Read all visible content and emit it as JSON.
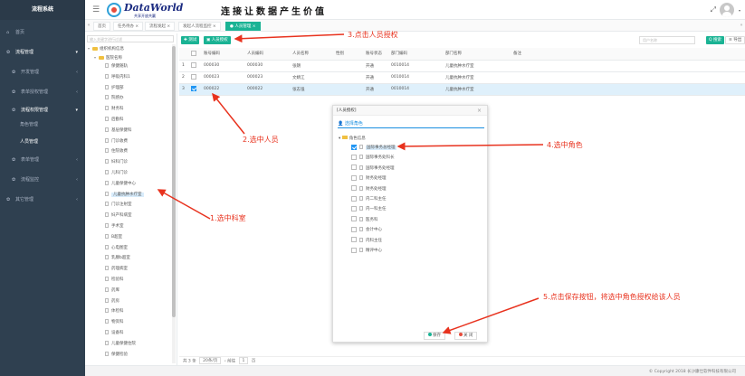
{
  "sidebar": {
    "brand": "流程系统",
    "items": [
      {
        "label": "首页",
        "icon": "home-icon"
      },
      {
        "label": "流程管理",
        "icon": "gear-icon"
      },
      {
        "label": "开发管理",
        "icon": "gear-icon"
      },
      {
        "label": "表单授权管理",
        "icon": "gear-icon"
      },
      {
        "label": "流程权限管理",
        "icon": "gear-icon"
      },
      {
        "label": "表单管理",
        "icon": "gear-icon"
      },
      {
        "label": "流程监控",
        "icon": "gear-icon"
      },
      {
        "label": "其它管理",
        "icon": "gear-icon"
      }
    ],
    "subitems": [
      {
        "label": "角色管理"
      },
      {
        "label": "人员管理"
      }
    ]
  },
  "header": {
    "logo_text": "DataWorld",
    "logo_sub": "共享开放共赢",
    "slogan": "连接让数据产生价值"
  },
  "tabs": [
    {
      "label": "首页"
    },
    {
      "label": "任务待办 ×"
    },
    {
      "label": "流程发起 ×"
    },
    {
      "label": "发起人流程监控 ×"
    },
    {
      "label": "● 人员管理 ×"
    }
  ],
  "tree": {
    "search_placeholder": "输入关键字进行过滤",
    "root": "组织机构信息",
    "group": "医院名称",
    "departments": [
      "保健随轨",
      "呼吸内科1",
      "护理部",
      "院感办",
      "财务科",
      "后勤科",
      "基层保健科",
      "门诊收费",
      "住院收费",
      "妇科门诊",
      "儿科门诊",
      "儿童保健中心",
      "儿童抗肿水疗室",
      "门诊注射室",
      "妇产科病室",
      "手术室",
      "B超室",
      "心电图室",
      "乳腺b超室",
      "药理病室",
      "检验科",
      "药库",
      "药房",
      "体检科",
      "物资科",
      "设备科",
      "儿童保健住院",
      "保健检验"
    ],
    "selected": "儿童抗肿水疗室"
  },
  "toolbar": {
    "add_label": "✚ 测试",
    "auth_label": "▣ 人员授权",
    "search_placeholder": "用户名称",
    "search_btn": "Q 搜索",
    "export_btn": "≡ 导出"
  },
  "table": {
    "headers": [
      "",
      "账号编码",
      "人员编码",
      "人员名称",
      "性别",
      "账号状态",
      "部门编码",
      "部门名称",
      "备注"
    ],
    "rows": [
      {
        "idx": "1",
        "account": "000030",
        "person": "000030",
        "name": "张朗",
        "gender": "",
        "status": "开通",
        "dept_code": "0010014",
        "dept_name": "儿童抗肿水疗室",
        "remark": "",
        "checked": false
      },
      {
        "idx": "2",
        "account": "000023",
        "person": "000023",
        "name": "文婧江",
        "gender": "",
        "status": "开通",
        "dept_code": "0010014",
        "dept_name": "儿童抗肿水疗室",
        "remark": "",
        "checked": false
      },
      {
        "idx": "3",
        "account": "000022",
        "person": "000022",
        "name": "张志强",
        "gender": "",
        "status": "开通",
        "dept_code": "0010014",
        "dept_name": "儿童抗肿水疗室",
        "remark": "",
        "checked": true
      }
    ]
  },
  "pager": {
    "total": "共 3 条",
    "page_size": "20条/页",
    "goto": "前往",
    "page": "1",
    "page_unit": "页"
  },
  "footer": {
    "copyright": "© Copyright 2018 长沙康仕软件科技有限公司"
  },
  "modal": {
    "title": "[人员授权]",
    "tab": "选择角色",
    "root": "角色信息",
    "roles": [
      {
        "label": "国际事务总经理",
        "checked": true
      },
      {
        "label": "国际事务处科长",
        "checked": false
      },
      {
        "label": "国际事务处经理",
        "checked": false
      },
      {
        "label": "财务处经理",
        "checked": false
      },
      {
        "label": "财务处经理",
        "checked": false
      },
      {
        "label": "内二科主任",
        "checked": false
      },
      {
        "label": "内一科主任",
        "checked": false
      },
      {
        "label": "医务科",
        "checked": false
      },
      {
        "label": "会计中心",
        "checked": false
      },
      {
        "label": "内科主任",
        "checked": false
      },
      {
        "label": "精评中心",
        "checked": false
      }
    ],
    "save_label": "保存",
    "close_label": "关 闭"
  },
  "annotations": {
    "step1": "1.选中科室",
    "step2": "2.选中人员",
    "step3": "3.点击人员授权",
    "step4": "4.选中角色",
    "step5": "5.点击保存按钮，将选中角色授权给该人员"
  },
  "colors": {
    "sidebar_bg": "#2f4050",
    "accent_green": "#1ab394",
    "annotation_red": "#e8321e",
    "select_blue": "#2196f3"
  }
}
